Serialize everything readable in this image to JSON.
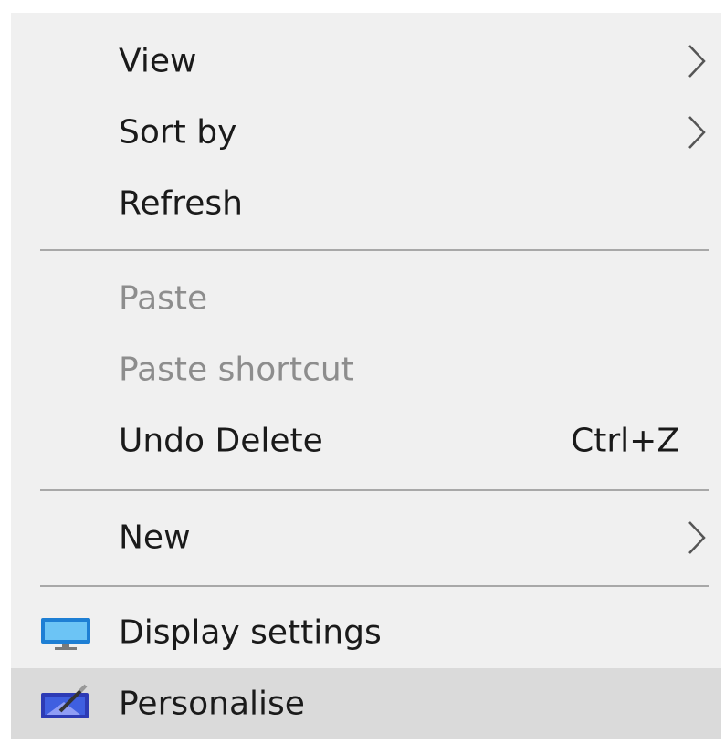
{
  "context_menu": {
    "items": [
      {
        "label": "View",
        "submenu": true
      },
      {
        "label": "Sort by",
        "submenu": true
      },
      {
        "label": "Refresh"
      },
      {
        "label": "Paste",
        "disabled": true
      },
      {
        "label": "Paste shortcut",
        "disabled": true
      },
      {
        "label": "Undo Delete",
        "shortcut": "Ctrl+Z"
      },
      {
        "label": "New",
        "submenu": true
      },
      {
        "label": "Display settings",
        "icon": "display-icon"
      },
      {
        "label": "Personalise",
        "icon": "personalise-icon",
        "highlighted": true
      }
    ]
  },
  "colors": {
    "menu_background": "#f0f0f0",
    "highlight": "#dadada",
    "disabled_text": "#8d8d8d",
    "separator": "#a8a8a8"
  }
}
